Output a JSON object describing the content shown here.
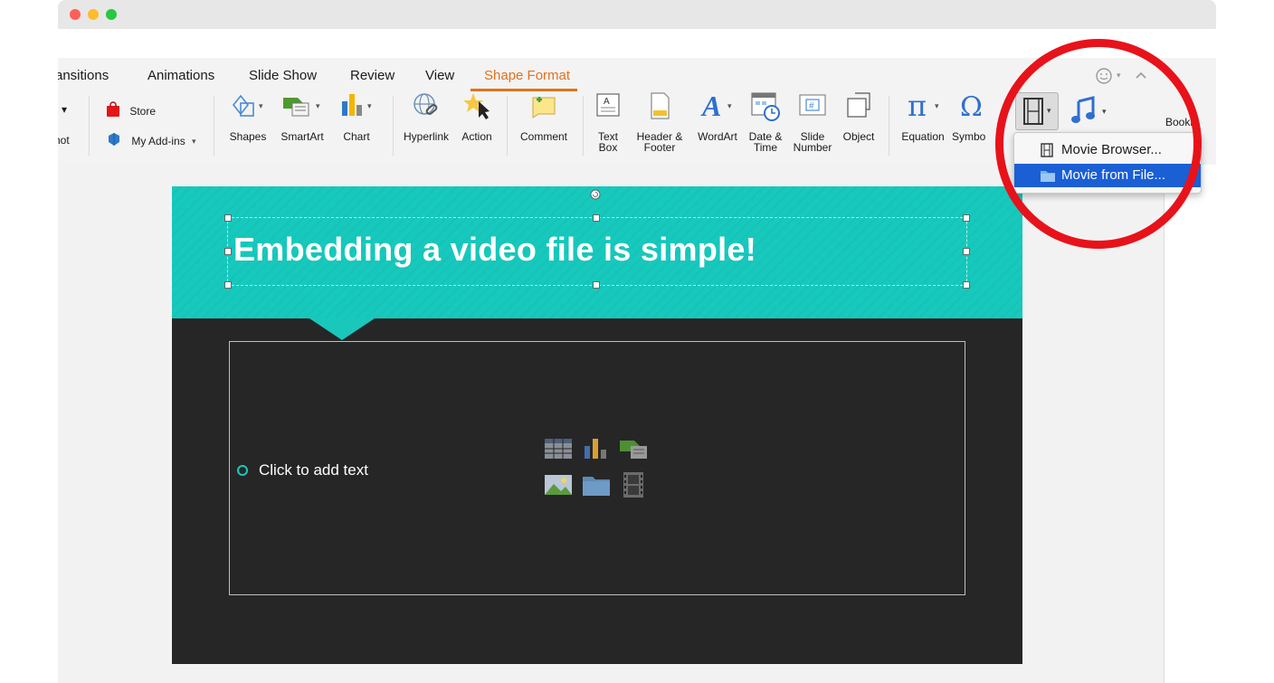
{
  "ribbon": {
    "tabs": [
      {
        "label": "ransitions"
      },
      {
        "label": "Animations"
      },
      {
        "label": "Slide Show"
      },
      {
        "label": "Review"
      },
      {
        "label": "View"
      },
      {
        "label": "Shape Format"
      }
    ],
    "active_tab": "Shape Format",
    "left_partial": {
      "top": "▾",
      "bottom": "hot"
    },
    "store_label": "Store",
    "addins_label": "My Add-ins",
    "tools": {
      "shapes": "Shapes",
      "smartart": "SmartArt",
      "chart": "Chart",
      "hyperlink": "Hyperlink",
      "action": "Action",
      "comment": "Comment",
      "textbox_l1": "Text",
      "textbox_l2": "Box",
      "header_l1": "Header &",
      "header_l2": "Footer",
      "wordart": "WordArt",
      "datetime_l1": "Date &",
      "datetime_l2": "Time",
      "slidenum_l1": "Slide",
      "slidenum_l2": "Number",
      "object": "Object",
      "equation": "Equation",
      "symbol": "Symbo",
      "bookmark": "Bookr"
    },
    "icons": {
      "store": "store-bag-icon",
      "addins": "addins-puzzle-icon",
      "movie": "film-strip-icon",
      "audio": "music-note-icon",
      "smiley": "smiley-icon",
      "collapse": "chevron-up-icon"
    }
  },
  "slide": {
    "title": "Embedding a video file is simple!",
    "bullet": "Click to add text"
  },
  "movie_menu": {
    "items": [
      {
        "label": "Movie Browser..."
      },
      {
        "label": "Movie from File..."
      }
    ],
    "selected": "Movie from File..."
  },
  "colors": {
    "accent": "#e2711d",
    "teal": "#16c9bd",
    "slide_bg": "#262626",
    "selection": "#1a5fd4",
    "annotation": "#e8121a"
  }
}
